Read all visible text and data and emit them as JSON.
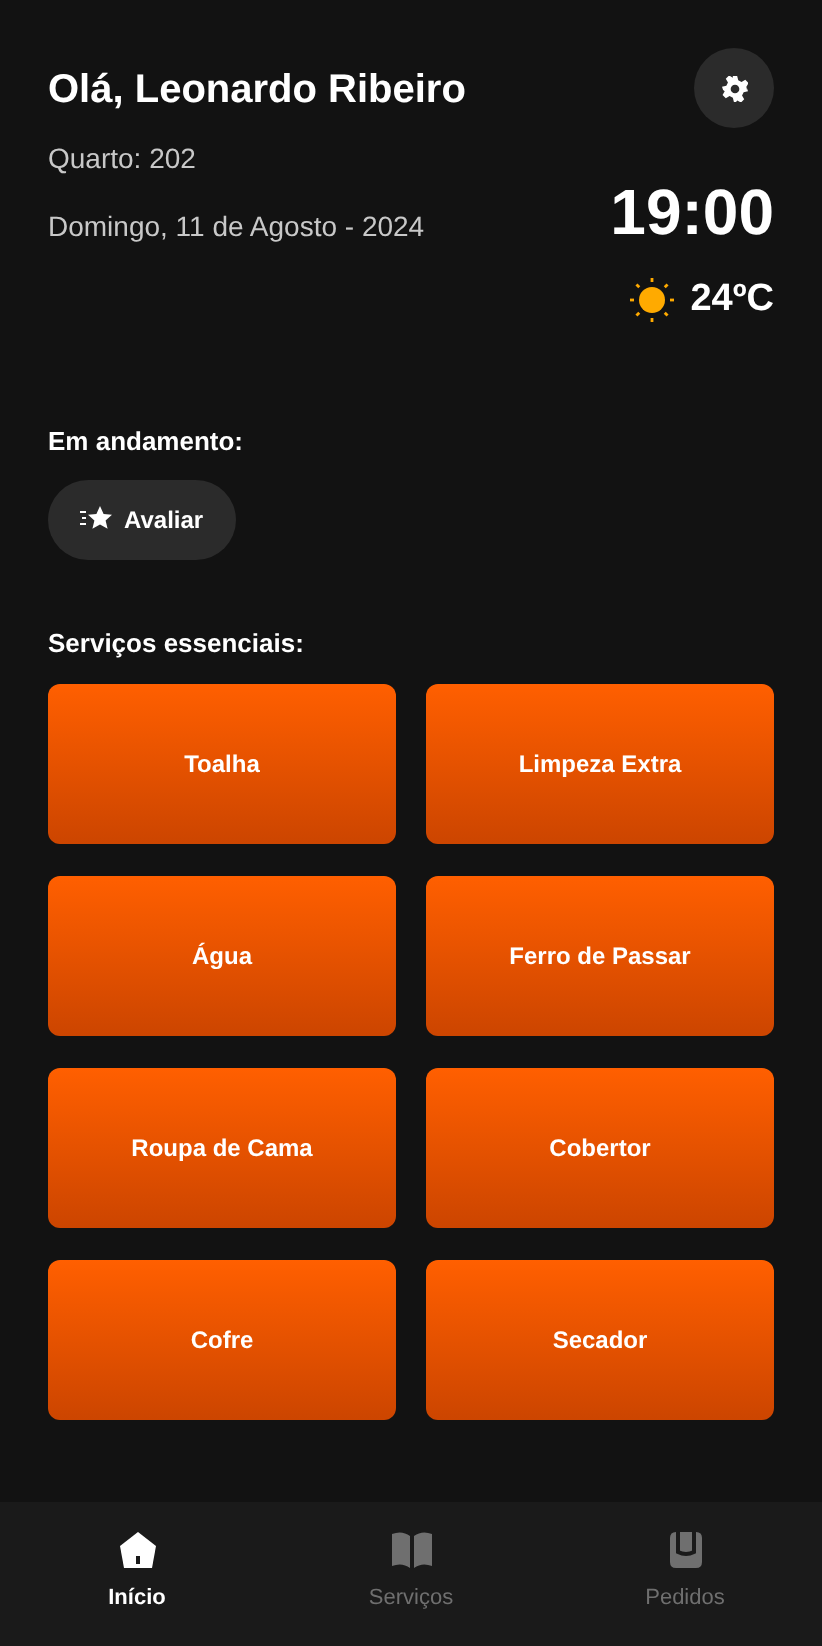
{
  "header": {
    "greeting": "Olá, Leonardo Ribeiro",
    "room": "Quarto: 202",
    "date": "Domingo, 11 de Agosto - 2024",
    "time": "19:00",
    "temperature": "24ºC"
  },
  "in_progress": {
    "title": "Em andamento:",
    "button": "Avaliar"
  },
  "services": {
    "title": "Serviços essenciais:",
    "items": [
      "Toalha",
      "Limpeza Extra",
      "Água",
      "Ferro de Passar",
      "Roupa de Cama",
      "Cobertor",
      "Cofre",
      "Secador"
    ]
  },
  "nav": [
    {
      "label": "Início",
      "kind": "home",
      "selected": true
    },
    {
      "label": "Serviços",
      "kind": "book",
      "selected": false
    },
    {
      "label": "Pedidos",
      "kind": "orders",
      "selected": false
    }
  ]
}
